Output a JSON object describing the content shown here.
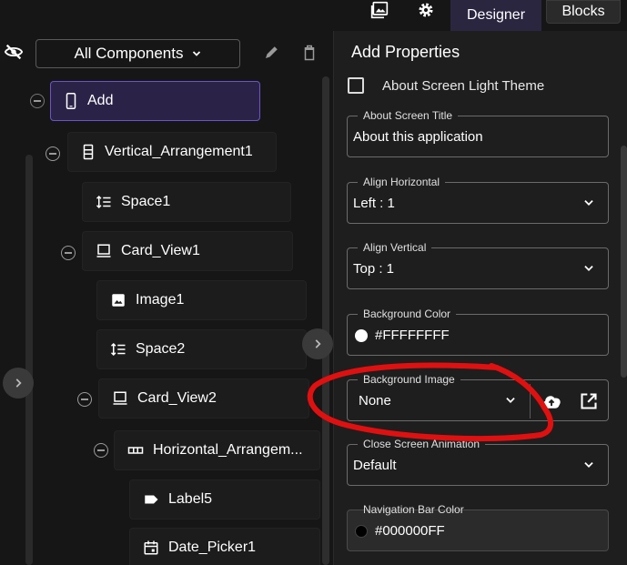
{
  "topbar": {
    "gallery_icon": "gallery-icon",
    "settings_icon": "gear-icon",
    "tab_designer": "Designer",
    "tab_blocks": "Blocks"
  },
  "tree": {
    "visibility_icon": "eye-off-icon",
    "component_filter": "All Components",
    "edit_icon": "pencil-icon",
    "delete_icon": "trash-icon",
    "nodes": [
      {
        "label": "Add",
        "icon": "phone-icon"
      },
      {
        "label": "Vertical_Arrangement1",
        "icon": "vertical-arrangement-icon"
      },
      {
        "label": "Space1",
        "icon": "line-spacing-icon"
      },
      {
        "label": "Card_View1",
        "icon": "card-view-icon"
      },
      {
        "label": "Image1",
        "icon": "image-icon"
      },
      {
        "label": "Space2",
        "icon": "line-spacing-icon"
      },
      {
        "label": "Card_View2",
        "icon": "card-view-icon"
      },
      {
        "label": "Horizontal_Arrangem...",
        "icon": "horizontal-arrangement-icon"
      },
      {
        "label": "Label5",
        "icon": "label-icon"
      },
      {
        "label": "Date_Picker1",
        "icon": "calendar-icon"
      }
    ]
  },
  "properties": {
    "title": "Add Properties",
    "light_theme_label": "About Screen Light Theme",
    "about_title_label": "About Screen Title",
    "about_title_value": "About this application",
    "align_h_label": "Align Horizontal",
    "align_h_value": "Left : 1",
    "align_v_label": "Align Vertical",
    "align_v_value": "Top : 1",
    "bg_color_label": "Background Color",
    "bg_color_value": "#FFFFFFFF",
    "bg_image_label": "Background Image",
    "bg_image_value": "None",
    "close_anim_label": "Close Screen Animation",
    "close_anim_value": "Default",
    "nav_color_label": "Navigation Bar Color",
    "nav_color_value": "#000000FF"
  },
  "colors": {
    "accent_purple": "#6b55c7",
    "annotation_red": "#e01010",
    "swatch_white": "#ffffff",
    "swatch_black": "#000000"
  }
}
